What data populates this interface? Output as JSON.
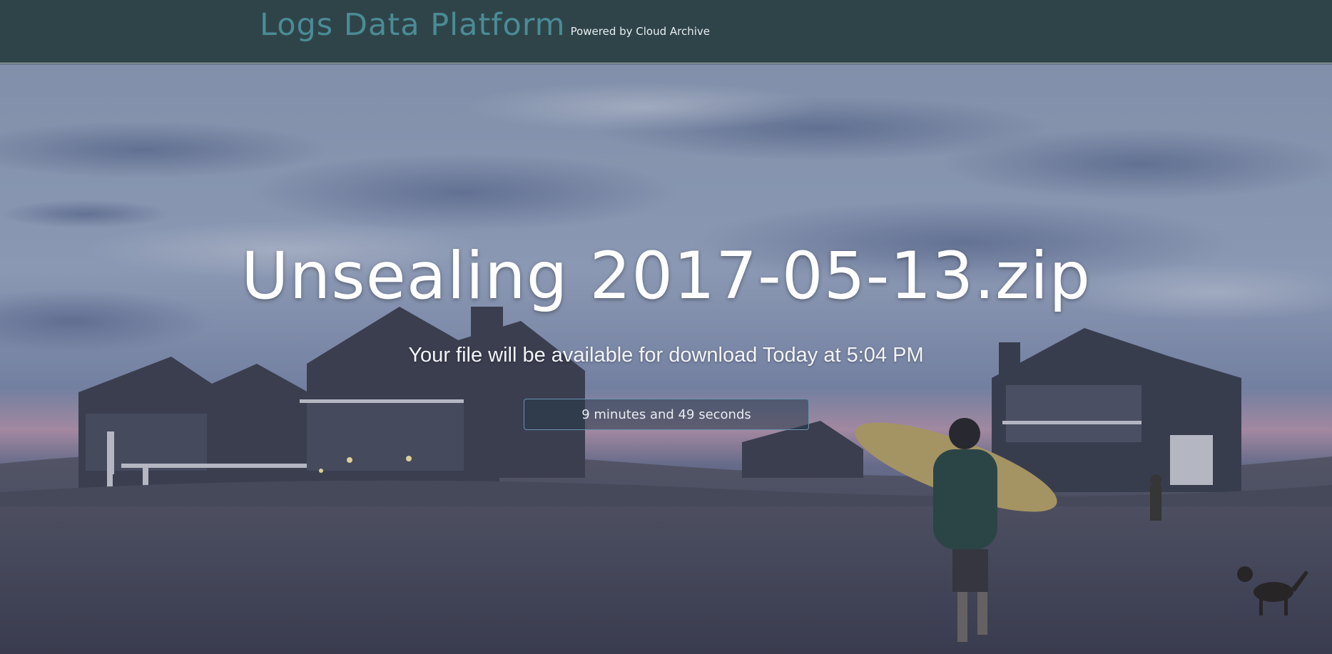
{
  "navbar": {
    "title": "Logs Data Platform",
    "subtitle": "Powered by Cloud Archive"
  },
  "main": {
    "headline": "Unsealing 2017-05-13.zip",
    "availability": "Your file will be available for download Today at 5:04 PM",
    "countdown": "9 minutes and 49 seconds"
  },
  "colors": {
    "navbar_bg": "#2f4449",
    "brand_accent": "#4a8c96",
    "headline_text": "#ffffff"
  }
}
